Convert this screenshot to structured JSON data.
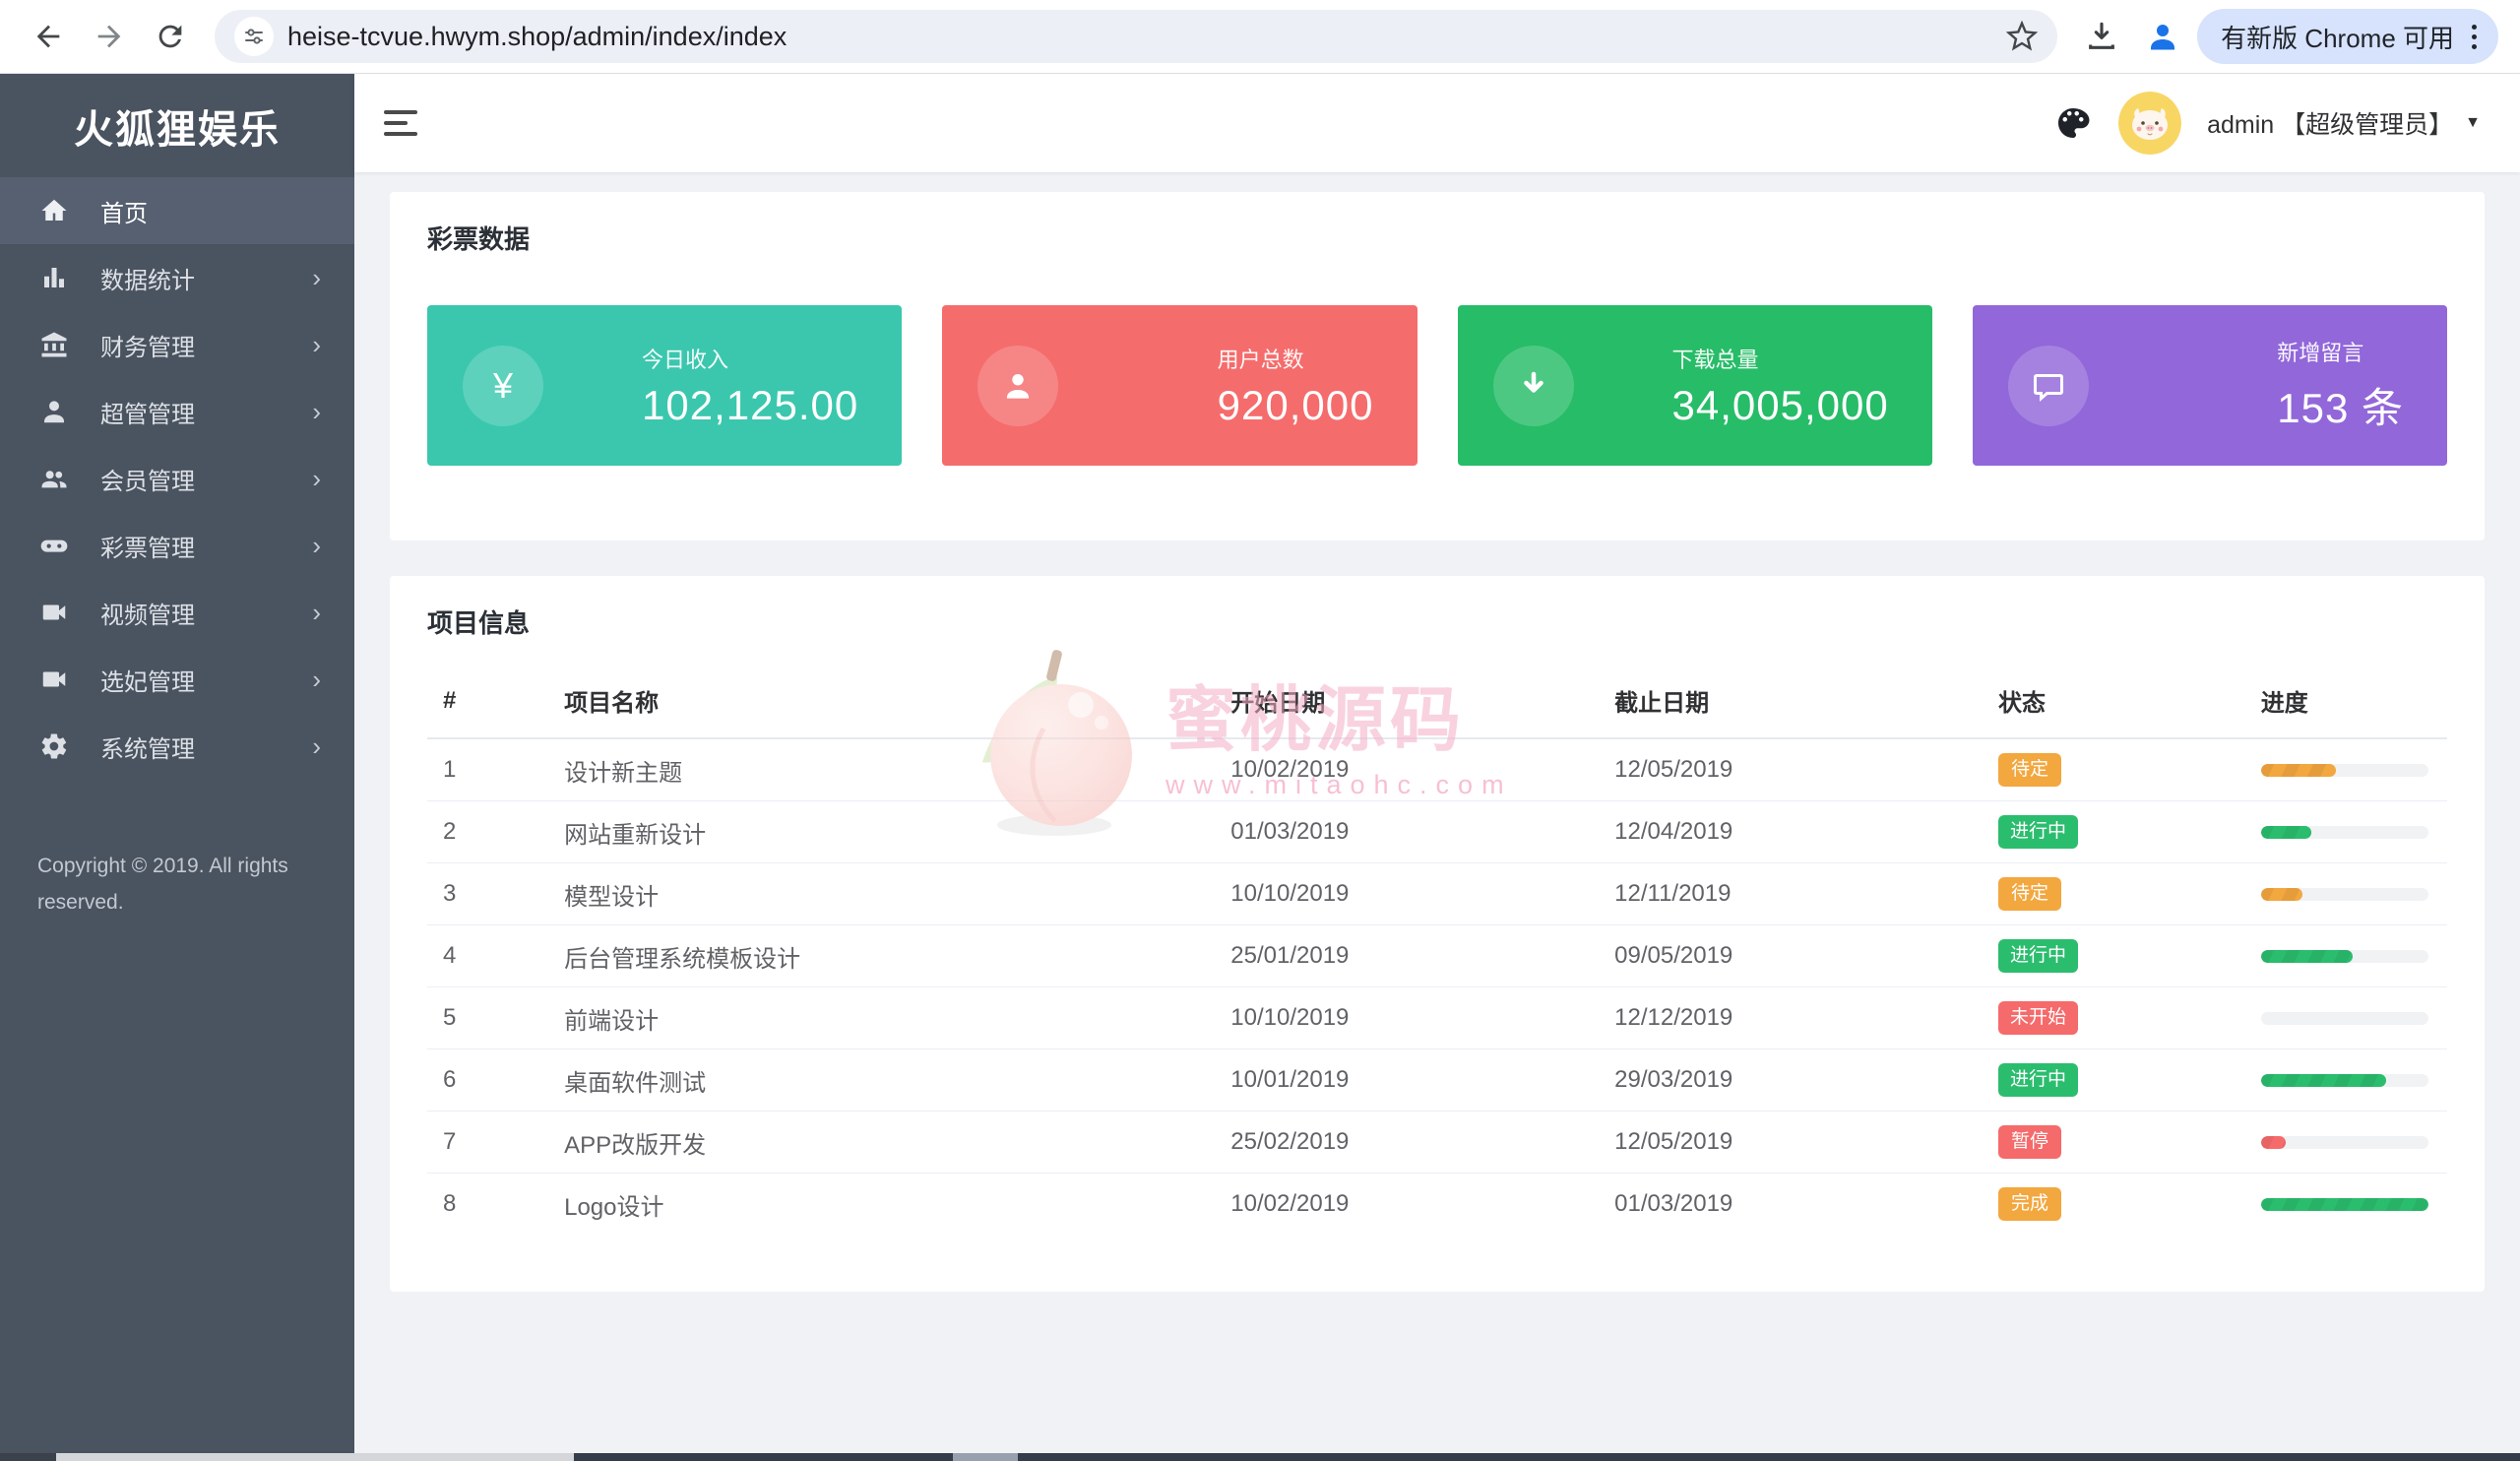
{
  "browser": {
    "url": "heise-tcvue.hwym.shop/admin/index/index",
    "update_badge": "有新版 Chrome 可用"
  },
  "icons": {
    "chevron": "›",
    "caret": "▼"
  },
  "sidebar": {
    "logo": "火狐狸娱乐",
    "items": [
      {
        "label": "首页"
      },
      {
        "label": "数据统计"
      },
      {
        "label": "财务管理"
      },
      {
        "label": "超管管理"
      },
      {
        "label": "会员管理"
      },
      {
        "label": "彩票管理"
      },
      {
        "label": "视频管理"
      },
      {
        "label": "选妃管理"
      },
      {
        "label": "系统管理"
      }
    ],
    "copyright": "Copyright © 2019. All rights reserved."
  },
  "header": {
    "user": "admin 【超级管理员】"
  },
  "stats": {
    "section_title": "彩票数据",
    "cards": [
      {
        "label": "今日收入",
        "value": "102,125.00",
        "icon": "yen-icon",
        "icon_char": "¥",
        "color": "#3ac7ae"
      },
      {
        "label": "用户总数",
        "value": "920,000",
        "icon": "person-icon",
        "color": "#f56c6c"
      },
      {
        "label": "下载总量",
        "value": "34,005,000",
        "icon": "download-arrow-icon",
        "color": "#27bc68"
      },
      {
        "label": "新增留言",
        "value": "153 条",
        "icon": "comment-icon",
        "color": "#9267d9"
      }
    ]
  },
  "projects": {
    "section_title": "项目信息",
    "columns": [
      "#",
      "项目名称",
      "开始日期",
      "截止日期",
      "状态",
      "进度"
    ],
    "rows": [
      {
        "num": "1",
        "name": "设计新主题",
        "start": "10/02/2019",
        "end": "12/05/2019",
        "status": "待定",
        "status_color": "#f3a73f",
        "progress": 45,
        "progress_color": "#f3a73f"
      },
      {
        "num": "2",
        "name": "网站重新设计",
        "start": "01/03/2019",
        "end": "12/04/2019",
        "status": "进行中",
        "status_color": "#2bbd6e",
        "progress": 30,
        "progress_color": "#2bbd6e"
      },
      {
        "num": "3",
        "name": "模型设计",
        "start": "10/10/2019",
        "end": "12/11/2019",
        "status": "待定",
        "status_color": "#f3a73f",
        "progress": 25,
        "progress_color": "#f3a73f"
      },
      {
        "num": "4",
        "name": "后台管理系统模板设计",
        "start": "25/01/2019",
        "end": "09/05/2019",
        "status": "进行中",
        "status_color": "#2bbd6e",
        "progress": 55,
        "progress_color": "#2bbd6e"
      },
      {
        "num": "5",
        "name": "前端设计",
        "start": "10/10/2019",
        "end": "12/12/2019",
        "status": "未开始",
        "status_color": "#f56a6b",
        "progress": 0,
        "progress_color": "#f56a6b"
      },
      {
        "num": "6",
        "name": "桌面软件测试",
        "start": "10/01/2019",
        "end": "29/03/2019",
        "status": "进行中",
        "status_color": "#2bbd6e",
        "progress": 75,
        "progress_color": "#2bbd6e"
      },
      {
        "num": "7",
        "name": "APP改版开发",
        "start": "25/02/2019",
        "end": "12/05/2019",
        "status": "暂停",
        "status_color": "#f56a6b",
        "progress": 15,
        "progress_color": "#f56a6b"
      },
      {
        "num": "8",
        "name": "Logo设计",
        "start": "10/02/2019",
        "end": "01/03/2019",
        "status": "完成",
        "status_color": "#f3a73f",
        "progress": 100,
        "progress_color": "#2bbd6e"
      }
    ]
  },
  "watermark": {
    "title": "蜜桃源码",
    "subtitle": "www.mitaohc.com"
  }
}
